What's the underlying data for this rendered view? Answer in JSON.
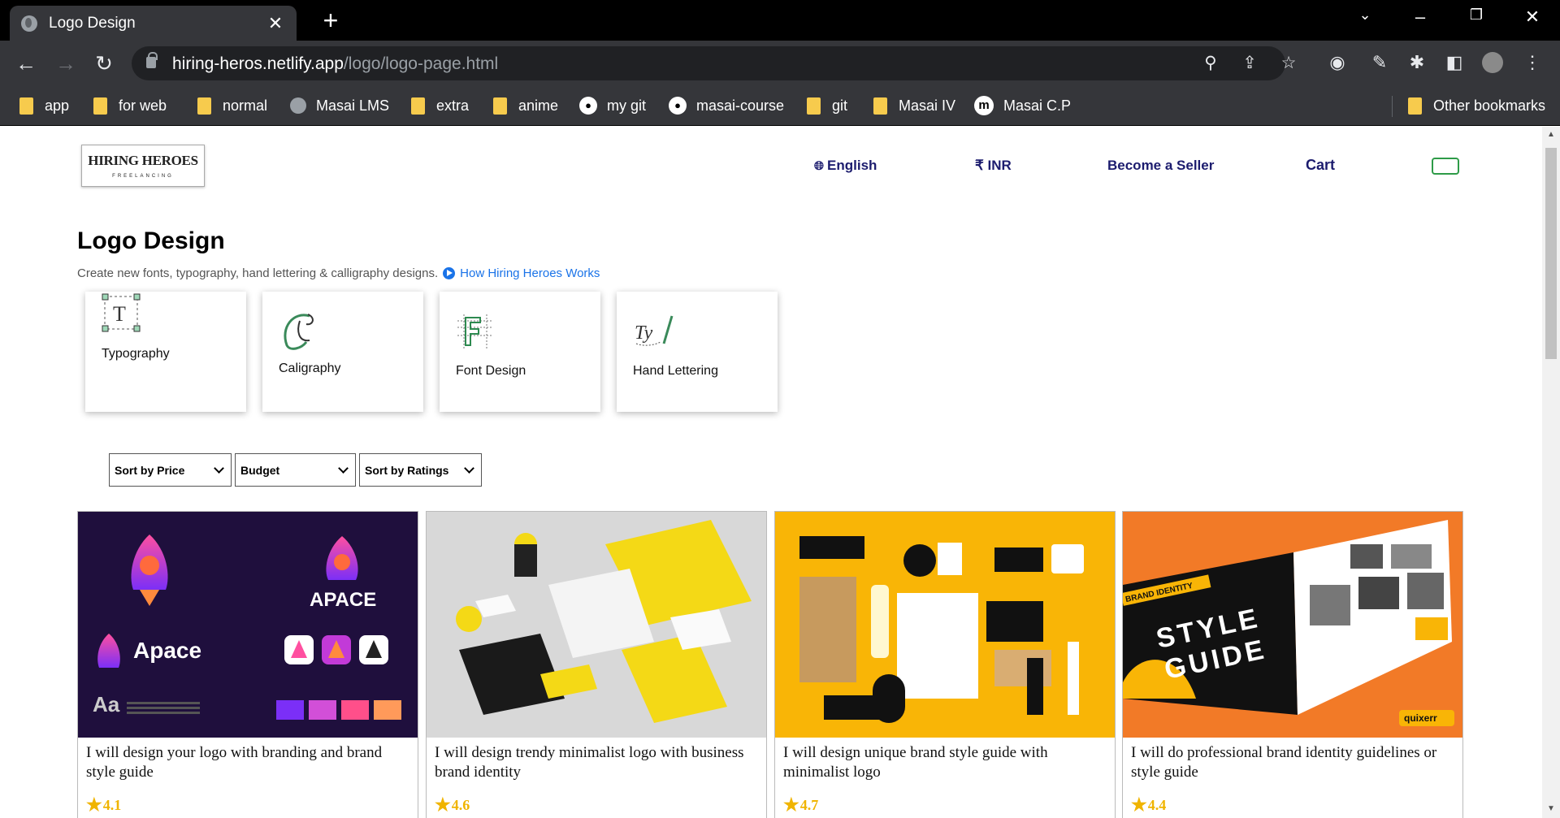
{
  "browser": {
    "tab_title": "Logo Design",
    "tab_close": "✕",
    "new_tab": "+",
    "url_host": "hiring-heros.netlify.app",
    "url_path": "/logo/logo-page.html",
    "bookmarks": [
      {
        "label": "app",
        "icon": "folder-icon"
      },
      {
        "label": "for web",
        "icon": "folder-icon"
      },
      {
        "label": "normal",
        "icon": "folder-icon"
      },
      {
        "label": "Masai LMS",
        "icon": "globe-icon"
      },
      {
        "label": "extra",
        "icon": "folder-icon"
      },
      {
        "label": "anime",
        "icon": "folder-icon"
      },
      {
        "label": "my git",
        "icon": "github-icon"
      },
      {
        "label": "masai-course",
        "icon": "github-icon"
      },
      {
        "label": "git",
        "icon": "folder-icon"
      },
      {
        "label": "Masai IV",
        "icon": "folder-icon"
      },
      {
        "label": "Masai C.P",
        "icon": "masai-icon"
      }
    ],
    "other_bookmarks": "Other bookmarks"
  },
  "header": {
    "logo_line1": "HIRING HEROES",
    "logo_line2": "FREELANCING",
    "language": "English",
    "currency": "₹ INR",
    "become_seller": "Become a Seller",
    "cart": "Cart"
  },
  "main": {
    "title": "Logo Design",
    "subtitle": "Create new fonts, typography, hand lettering & calligraphy designs.",
    "how_link": "How Hiring Heroes Works",
    "categories": [
      {
        "label": "Typography",
        "icon": "typography-icon"
      },
      {
        "label": "Caligraphy",
        "icon": "calligraphy-icon"
      },
      {
        "label": "Font Design",
        "icon": "font-design-icon"
      },
      {
        "label": "Hand Lettering",
        "icon": "hand-lettering-icon"
      }
    ],
    "filters": [
      "Sort by Price",
      "Budget",
      "Sort by Ratings"
    ],
    "gigs": [
      {
        "title": "I will design your logo with branding and brand style guide",
        "rating": "4.1",
        "img_text1": "APACE",
        "img_text2": "Apace",
        "img_text3": "Aa"
      },
      {
        "title": "I will design trendy minimalist logo with business brand identity",
        "rating": "4.6"
      },
      {
        "title": "I will design unique brand style guide with minimalist logo",
        "rating": "4.7"
      },
      {
        "title": "I will do professional brand identity guidelines or style guide",
        "rating": "4.4",
        "img_text1": "STYLE",
        "img_text2": "GUIDE",
        "img_text3": "BRAND IDENTITY",
        "img_text4": "quixerr"
      }
    ]
  },
  "colors": {
    "accent": "#1c1c6e",
    "star": "#f0b400",
    "link": "#1a73e8"
  }
}
